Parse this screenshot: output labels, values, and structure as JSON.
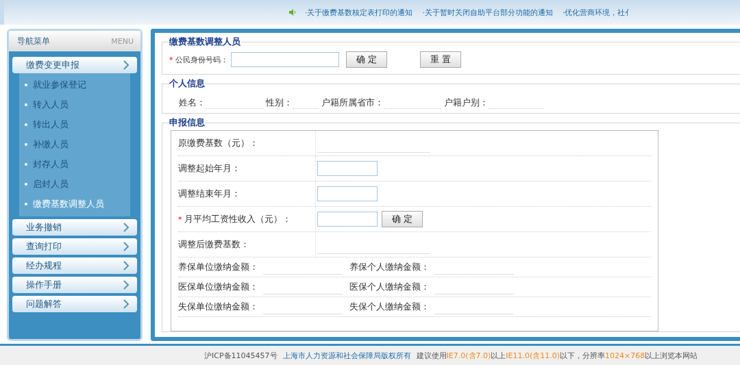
{
  "notices": [
    "·关于缴费基数核定表打印的通知",
    "·关于暂时关闭自助平台部分功能的通知",
    "·优化营商环境，社亻"
  ],
  "sidebar": {
    "title": "导航菜单",
    "subtitle": "MENU",
    "groups": [
      {
        "label": "缴费变更申报",
        "items": [
          {
            "label": "就业参保登记",
            "selected": false
          },
          {
            "label": "转入人员",
            "selected": false
          },
          {
            "label": "转出人员",
            "selected": false
          },
          {
            "label": "补缴人员",
            "selected": false
          },
          {
            "label": "封存人员",
            "selected": false
          },
          {
            "label": "启封人员",
            "selected": false
          },
          {
            "label": "缴费基数调整人员",
            "selected": true
          }
        ]
      },
      {
        "label": "业务撤销"
      },
      {
        "label": "查询打印"
      },
      {
        "label": "经办规程"
      },
      {
        "label": "操作手册"
      },
      {
        "label": "问题解答"
      }
    ]
  },
  "search": {
    "legend": "缴费基数调整人员",
    "required_mark": "*",
    "label": "公民身份号码：",
    "confirm": "确 定",
    "reset": "重 置"
  },
  "personal": {
    "legend": "个人信息",
    "fields": [
      "姓名：",
      "性别：",
      "户籍所属省市：",
      "户籍户别："
    ]
  },
  "declaration": {
    "legend": "申报信息",
    "rows": [
      {
        "label": "原缴费基数（元）：",
        "kind": "text",
        "required": false
      },
      {
        "label": "调整起始年月：",
        "kind": "input",
        "required": false
      },
      {
        "label": "调整结束年月：",
        "kind": "input",
        "required": false
      },
      {
        "label": "月平均工资性收入（元）：",
        "kind": "input_button",
        "required": true,
        "button": "确 定"
      },
      {
        "label": "调整后缴费基数：",
        "kind": "text",
        "required": false
      }
    ],
    "pairs": [
      [
        "养保单位缴纳金额：",
        "养保个人缴纳金额："
      ],
      [
        "医保单位缴纳金额：",
        "医保个人缴纳金额："
      ],
      [
        "失保单位缴纳金额：",
        "失保个人缴纳金额："
      ]
    ]
  },
  "footer": {
    "icp": "沪ICP备11045457号",
    "link": "上海市人力资源和社会保障局版权所有",
    "notice": [
      {
        "text": "建议使用",
        "highlight": false
      },
      {
        "text": "IE7.0(含7.0)",
        "highlight": true
      },
      {
        "text": "以上",
        "highlight": false
      },
      {
        "text": "IE11.0(含11.0)",
        "highlight": true
      },
      {
        "text": "以下，分辨率",
        "highlight": false
      },
      {
        "text": "1024×768",
        "highlight": true
      },
      {
        "text": "以上浏览本网站",
        "highlight": false
      }
    ]
  }
}
